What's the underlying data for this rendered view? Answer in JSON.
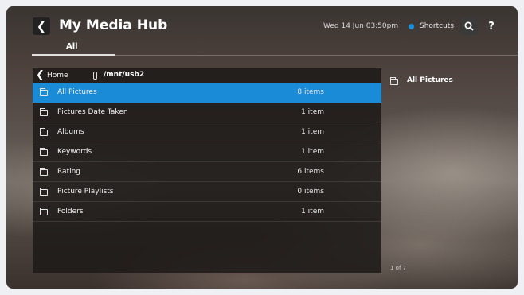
{
  "header": {
    "title": "My Media Hub",
    "datetime": "Wed 14 Jun 03:50pm",
    "shortcuts_label": "Shortcuts",
    "back_icon": "chevron-left-icon",
    "search_icon": "search-icon",
    "help_icon": "help-icon",
    "accent_color": "#1a8cd8"
  },
  "tabs": [
    {
      "label": "All",
      "active": true
    }
  ],
  "breadcrumb": {
    "home_label": "Home",
    "path": "/mnt/usb2"
  },
  "list": {
    "selected_index": 0,
    "items": [
      {
        "label": "All Pictures",
        "count": "8 items"
      },
      {
        "label": "Pictures Date Taken",
        "count": "1 item"
      },
      {
        "label": "Albums",
        "count": "1 item"
      },
      {
        "label": "Keywords",
        "count": "1 item"
      },
      {
        "label": "Rating",
        "count": "6 items"
      },
      {
        "label": "Picture Playlists",
        "count": "0 items"
      },
      {
        "label": "Folders",
        "count": "1 item"
      }
    ]
  },
  "preview": {
    "title": "All Pictures",
    "pager": "1 of 7"
  }
}
